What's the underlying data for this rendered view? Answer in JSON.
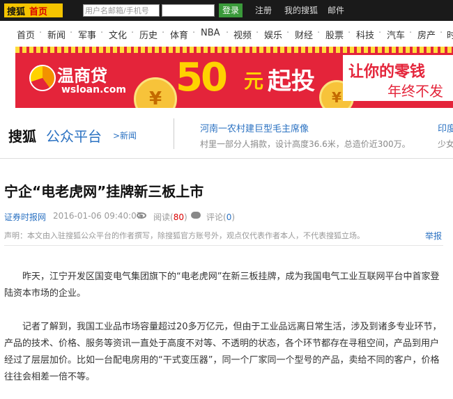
{
  "topbar": {
    "brand": "搜狐",
    "home": "首页",
    "username_placeholder": "用户名邮箱/手机号",
    "login": "登录",
    "register": "注册",
    "my_sohu": "我的搜狐",
    "mail": "邮件"
  },
  "channels": [
    "首页",
    "新闻",
    "军事",
    "文化",
    "历史",
    "体育",
    "NBA",
    "视频",
    "娱乐",
    "财经",
    "股票",
    "科技",
    "汽车",
    "房产",
    "时"
  ],
  "banner": {
    "name": "温商贷",
    "site": "wsloan.com",
    "amount": "50",
    "unit": "元",
    "start": "起投",
    "slogan1": "让你的零钱",
    "slogan2": "年终不发",
    "coin_symbol": "¥"
  },
  "platform": {
    "brand": "搜狐",
    "name": "公众平台",
    "section": ">新闻",
    "headline1_title": "河南一农村建巨型毛主席像",
    "headline1_desc": "村里一部分人捐款，设计高度36.6米，总造价近300万。",
    "headline2_title": "印度",
    "headline2_desc": "少女"
  },
  "article": {
    "title": "宁企“电老虎网”挂牌新三板上市",
    "source": "证券时报网",
    "date": "2016-01-06 09:40:07",
    "read_label": "阅读",
    "read_count": "80",
    "comment_label": "评论",
    "comment_count": "0",
    "declaration": "声明：本文由入驻搜狐公众平台的作者撰写，除搜狐官方账号外，观点仅代表作者本人，不代表搜狐立场。",
    "report": "举报",
    "paragraphs": [
      "昨天，江宁开发区国变电气集团旗下的“电老虎网”在新三板挂牌，成为我国电气工业互联网平台中首家登陆资本市场的企业。",
      "记者了解到，我国工业品市场容量超过20多万亿元，但由于工业品远离日常生活，涉及到诸多专业环节，产品的技术、价格、服务等资讯一直处于高度不对等、不透明的状态，各个环节都存在寻租空间，产品到用户经过了层层加价。比如一台配电房用的“干式变压器”，同一个厂家同一个型号的产品，卖给不同的客户，价格往往会相差一倍不等。"
    ]
  }
}
